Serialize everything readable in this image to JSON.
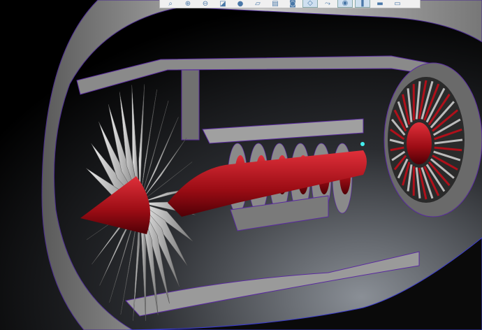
{
  "toolbar": {
    "buttons": [
      {
        "name": "zoom-fit",
        "glyph": "⌕"
      },
      {
        "name": "zoom-in",
        "glyph": "⊕"
      },
      {
        "name": "zoom-out",
        "glyph": "⊖"
      },
      {
        "name": "repaint",
        "glyph": "◪"
      },
      {
        "name": "display-style",
        "glyph": "●"
      },
      {
        "name": "saved-views",
        "glyph": "▱"
      },
      {
        "name": "view-manager",
        "glyph": "▤"
      },
      {
        "name": "camera",
        "glyph": "◙"
      },
      {
        "name": "perspective",
        "glyph": "◇"
      },
      {
        "name": "spin-center",
        "glyph": "⤳"
      },
      {
        "name": "visibility",
        "glyph": "◉"
      },
      {
        "name": "annotation",
        "glyph": "❚"
      },
      {
        "name": "layers",
        "glyph": "▬"
      },
      {
        "name": "more",
        "glyph": "▭"
      }
    ]
  },
  "colors": {
    "red": "#b0101a",
    "grey": "#8c8c8c",
    "edge": "#5a2aa0",
    "bg": "#000000"
  }
}
